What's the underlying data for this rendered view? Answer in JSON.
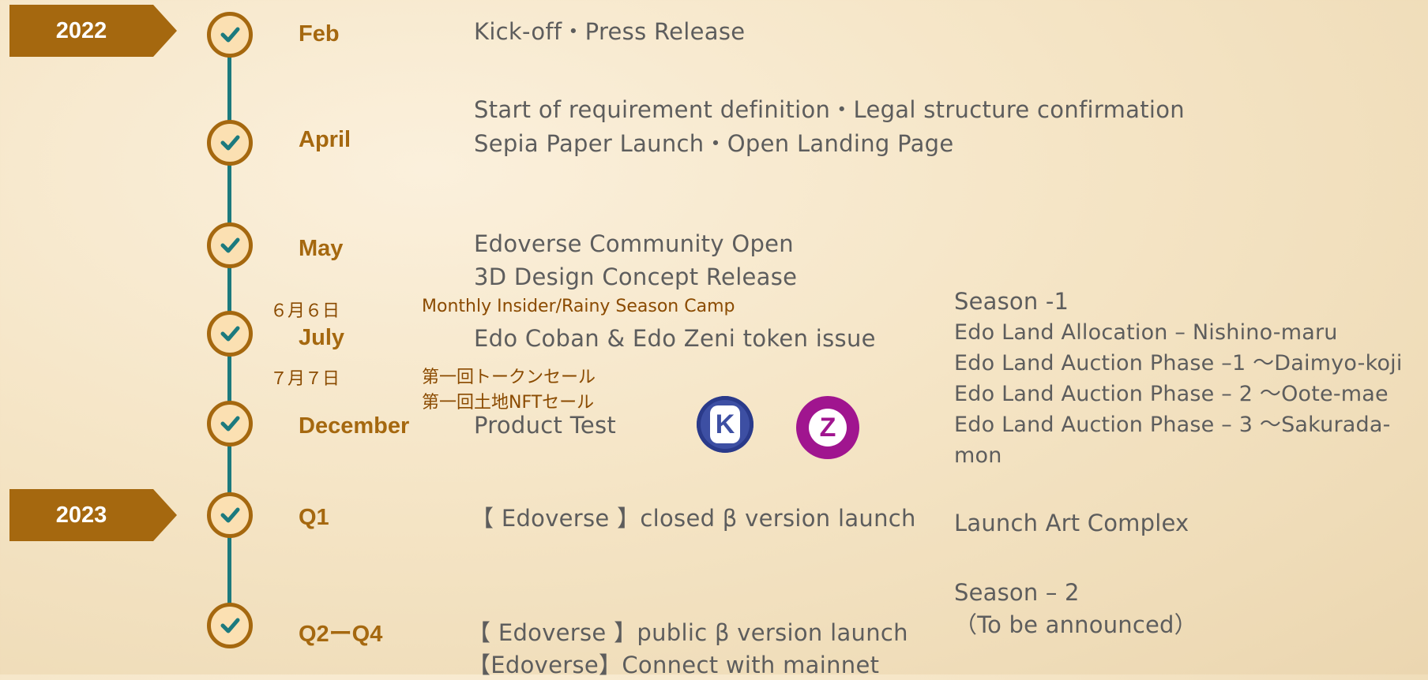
{
  "years": [
    {
      "label": "2022"
    },
    {
      "label": "2023"
    }
  ],
  "milestones": [
    {
      "period": "Feb",
      "events": [
        "Kick-off・Press Release"
      ]
    },
    {
      "period": "April",
      "events": [
        "Start of requirement definition・Legal structure confirmation",
        "Sepia Paper Launch・Open Landing Page"
      ]
    },
    {
      "period": "May",
      "events": [
        "Edoverse Community Open",
        "3D Design Concept Release"
      ]
    },
    {
      "period": "July",
      "events": [
        "Edo Coban & Edo Zeni token issue"
      ]
    },
    {
      "period": "December",
      "events": [
        "Product Test"
      ]
    },
    {
      "period": "Q1",
      "events": [
        "【 Edoverse 】closed β version launch"
      ]
    },
    {
      "period": "Q2ーQ4",
      "events": [
        "【 Edoverse 】public β version launch",
        "【Edoverse】Connect with mainnet"
      ]
    }
  ],
  "japan_events": [
    {
      "date": "６月６日",
      "text": "Monthly Insider/Rainy Season Camp"
    },
    {
      "date": "７月７日",
      "text": "第一回トークンセール"
    },
    {
      "date": "",
      "text": "第一回土地NFTセール"
    }
  ],
  "season1": {
    "title": "Season -1",
    "items": [
      "Edo Land Allocation – Nishino-maru",
      "Edo Land Auction Phase –1 ～Daimyo-koji",
      "Edo Land Auction Phase – 2 ～Oote-mae",
      "Edo Land Auction Phase – 3 ～Sakurada-",
      "mon"
    ]
  },
  "q1_side": "Launch Art Complex",
  "season2": {
    "title": "Season – 2",
    "subtitle": "（To be announced）"
  },
  "tokens": [
    {
      "letter": "K",
      "icon": "edo-coban-token-icon",
      "color": "#3d4fa3"
    },
    {
      "letter": "Z",
      "icon": "edo-zeni-token-icon",
      "color": "#a0158f"
    }
  ],
  "colors": {
    "accent": "#a5680f",
    "timeline": "#1c7a7e",
    "text": "#5d5d5d"
  }
}
